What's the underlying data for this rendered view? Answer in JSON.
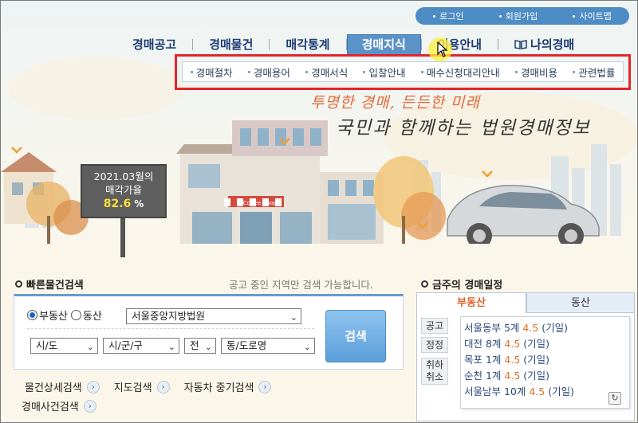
{
  "util_bar": {
    "items": [
      "로그인",
      "회원가입",
      "사이트맵"
    ]
  },
  "nav": {
    "items": [
      "경매공고",
      "경매물건",
      "매각통계",
      "경매지식",
      "이용안내",
      "나의경매"
    ],
    "active_index": 3
  },
  "submenu": {
    "items": [
      "경매절차",
      "경매용어",
      "경매서식",
      "입찰안내",
      "매수신청대리안내",
      "경매비용",
      "관련법률"
    ]
  },
  "hero": {
    "slogan1": "투명한 경매, 든든한 미래",
    "slogan2": "국민과 함께하는 법원경매정보",
    "rate_board": {
      "line1": "2021.03월의",
      "line2": "매각가율",
      "value": "82.6",
      "unit": "%"
    },
    "shop_sign": "Coffee Shop"
  },
  "quick_search": {
    "title": "빠른물건검색",
    "note": "공고 중인 지역만 검색 가능합니다.",
    "radio_options": [
      "부동산",
      "동산"
    ],
    "radio_selected": 0,
    "court_select": "서울중앙지방법원",
    "sido_select": "시/도",
    "sigungu_select": "시/군/구",
    "jeon_select": "전",
    "dong_select": "동/도로명",
    "search_button": "검색",
    "links": [
      "물건상세검색",
      "지도검색",
      "자동차 중기검색",
      "경매사건검색"
    ]
  },
  "schedule": {
    "title": "금주의 경매일정",
    "tabs": [
      "부동산",
      "동산"
    ],
    "active_tab": 0,
    "status_labels": [
      "공고",
      "정정",
      "취하",
      "취소"
    ],
    "entries": [
      {
        "court": "서울동부 5계",
        "num": "4.5",
        "suffix": "(기일)"
      },
      {
        "court": "대전 8계",
        "num": "4.5",
        "suffix": "(기일)"
      },
      {
        "court": "목포 1계",
        "num": "4.5",
        "suffix": "(기일)"
      },
      {
        "court": "순천 1계",
        "num": "4.5",
        "suffix": "(기일)"
      },
      {
        "court": "서울남부 10계",
        "num": "4.5",
        "suffix": "(기일)"
      }
    ]
  },
  "colors": {
    "brand_blue": "#4d8cc4",
    "highlight_red": "#e3252b",
    "accent_orange": "#e0602a"
  }
}
